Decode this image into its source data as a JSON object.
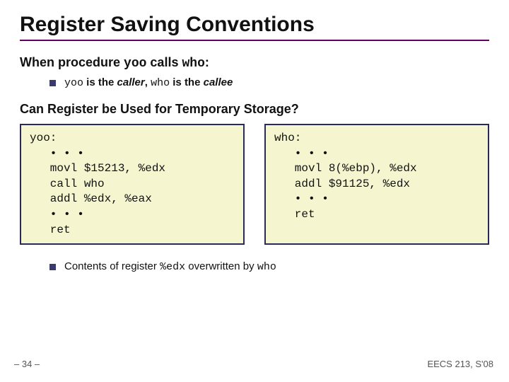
{
  "title": "Register Saving Conventions",
  "section1": {
    "prefix": "When procedure ",
    "code1": "yoo",
    "mid": " calls ",
    "code2": "who",
    "suffix": ":"
  },
  "bullet1": {
    "c1": "yoo",
    "t1": " is the ",
    "i1": "caller",
    "t2": ", ",
    "c2": "who",
    "t3": " is the ",
    "i2": "callee"
  },
  "section2": "Can Register be Used for Temporary Storage?",
  "code_yoo": "yoo:\n   • • •\n   movl $15213, %edx\n   call who\n   addl %edx, %eax\n   • • •\n   ret",
  "code_who": "who:\n   • • •\n   movl 8(%ebp), %edx\n   addl $91125, %edx\n   • • •\n   ret",
  "bullet2": {
    "t1": "Contents of register ",
    "c1": "%edx",
    "t2": " overwritten by ",
    "c2": "who"
  },
  "footer": {
    "left": "– 34 –",
    "right": "EECS 213, S'08"
  }
}
